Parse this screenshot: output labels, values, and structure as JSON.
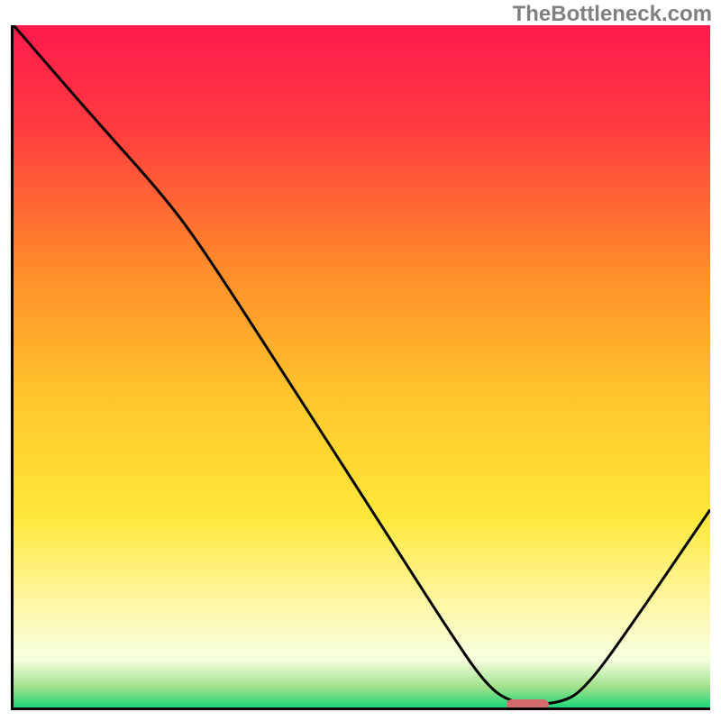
{
  "watermark": "TheBottleneck.com",
  "chart_data": {
    "type": "line",
    "title": "",
    "xlabel": "",
    "ylabel": "",
    "x_range_pct": [
      0,
      100
    ],
    "y_range_pct": [
      0,
      100
    ],
    "gradient_stops": [
      {
        "pct": 0,
        "color": "#ff1a4d"
      },
      {
        "pct": 15,
        "color": "#ff3b3f"
      },
      {
        "pct": 35,
        "color": "#ff8a2b"
      },
      {
        "pct": 55,
        "color": "#ffc72b"
      },
      {
        "pct": 72,
        "color": "#ffe83a"
      },
      {
        "pct": 85,
        "color": "#fff7a8"
      },
      {
        "pct": 93,
        "color": "#f6ffe0"
      },
      {
        "pct": 97,
        "color": "#9fe28a"
      },
      {
        "pct": 100,
        "color": "#1fd67a"
      }
    ],
    "series": [
      {
        "name": "bottleneck-curve",
        "points_pct": [
          {
            "x": 0.0,
            "y": 100.0
          },
          {
            "x": 11.0,
            "y": 87.0
          },
          {
            "x": 22.0,
            "y": 74.5
          },
          {
            "x": 28.0,
            "y": 66.0
          },
          {
            "x": 40.0,
            "y": 47.0
          },
          {
            "x": 52.0,
            "y": 28.0
          },
          {
            "x": 62.0,
            "y": 12.0
          },
          {
            "x": 68.0,
            "y": 3.0
          },
          {
            "x": 72.0,
            "y": 0.5
          },
          {
            "x": 78.0,
            "y": 0.5
          },
          {
            "x": 82.0,
            "y": 2.5
          },
          {
            "x": 90.0,
            "y": 14.0
          },
          {
            "x": 100.0,
            "y": 29.0
          }
        ]
      }
    ],
    "marker": {
      "x_pct": 73.5,
      "y_pct": 0.8,
      "width_pct": 6.0,
      "height_pct": 1.5,
      "color": "#d46a6a"
    }
  }
}
